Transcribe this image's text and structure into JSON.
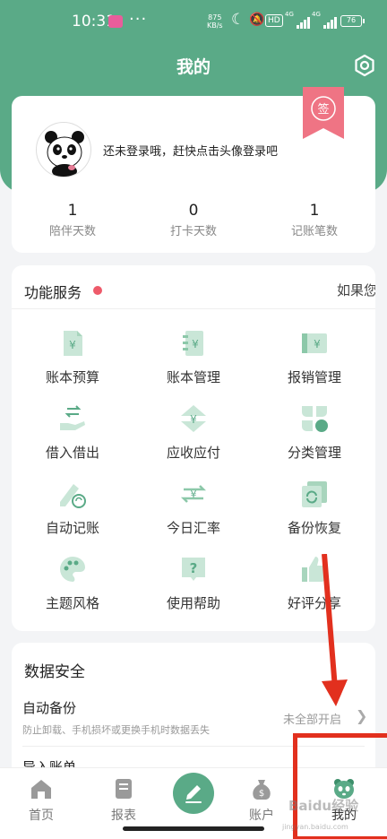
{
  "status_bar": {
    "time": "10:31",
    "dots": "···",
    "speed_top": "875",
    "speed_bottom": "KB/s",
    "hd": "HD",
    "sig1": "4G",
    "sig2": "4G",
    "battery": "76"
  },
  "header": {
    "title": "我的"
  },
  "profile": {
    "login_hint": "还未登录哦，赶快点击头像登录吧",
    "sign_badge": "签",
    "stats": [
      {
        "value": "1",
        "label": "陪伴天数"
      },
      {
        "value": "0",
        "label": "打卡天数"
      },
      {
        "value": "1",
        "label": "记账笔数"
      }
    ]
  },
  "functions": {
    "title": "功能服务",
    "marquee": "如果您",
    "items": [
      {
        "label": "账本预算",
        "icon": "ledger-budget-icon"
      },
      {
        "label": "账本管理",
        "icon": "ledger-manage-icon"
      },
      {
        "label": "报销管理",
        "icon": "reimburse-icon"
      },
      {
        "label": "借入借出",
        "icon": "borrow-lend-icon"
      },
      {
        "label": "应收应付",
        "icon": "receivable-payable-icon"
      },
      {
        "label": "分类管理",
        "icon": "category-icon"
      },
      {
        "label": "自动记账",
        "icon": "auto-record-icon"
      },
      {
        "label": "今日汇率",
        "icon": "exchange-rate-icon"
      },
      {
        "label": "备份恢复",
        "icon": "backup-restore-icon"
      },
      {
        "label": "主题风格",
        "icon": "theme-palette-icon"
      },
      {
        "label": "使用帮助",
        "icon": "help-icon"
      },
      {
        "label": "好评分享",
        "icon": "thumbs-up-icon"
      }
    ]
  },
  "data_safety": {
    "title": "数据安全",
    "auto_backup_title": "自动备份",
    "auto_backup_sub": "防止卸载、手机损坏或更换手机时数据丢失",
    "auto_backup_value": "未全部开启",
    "import_title": "导入账单"
  },
  "bottom_nav": {
    "items": [
      {
        "label": "首页",
        "icon": "home-icon"
      },
      {
        "label": "报表",
        "icon": "report-icon"
      },
      {
        "label": "账户",
        "icon": "account-moneybag-icon"
      },
      {
        "label": "我的",
        "icon": "panda-icon"
      }
    ]
  },
  "watermark": {
    "text": "Baidu经验",
    "sub": "jingyan.baidu.com"
  },
  "colors": {
    "brand_green": "#5aaa87",
    "accent_red": "#e2301e",
    "badge_pink": "#ee5a6a"
  }
}
